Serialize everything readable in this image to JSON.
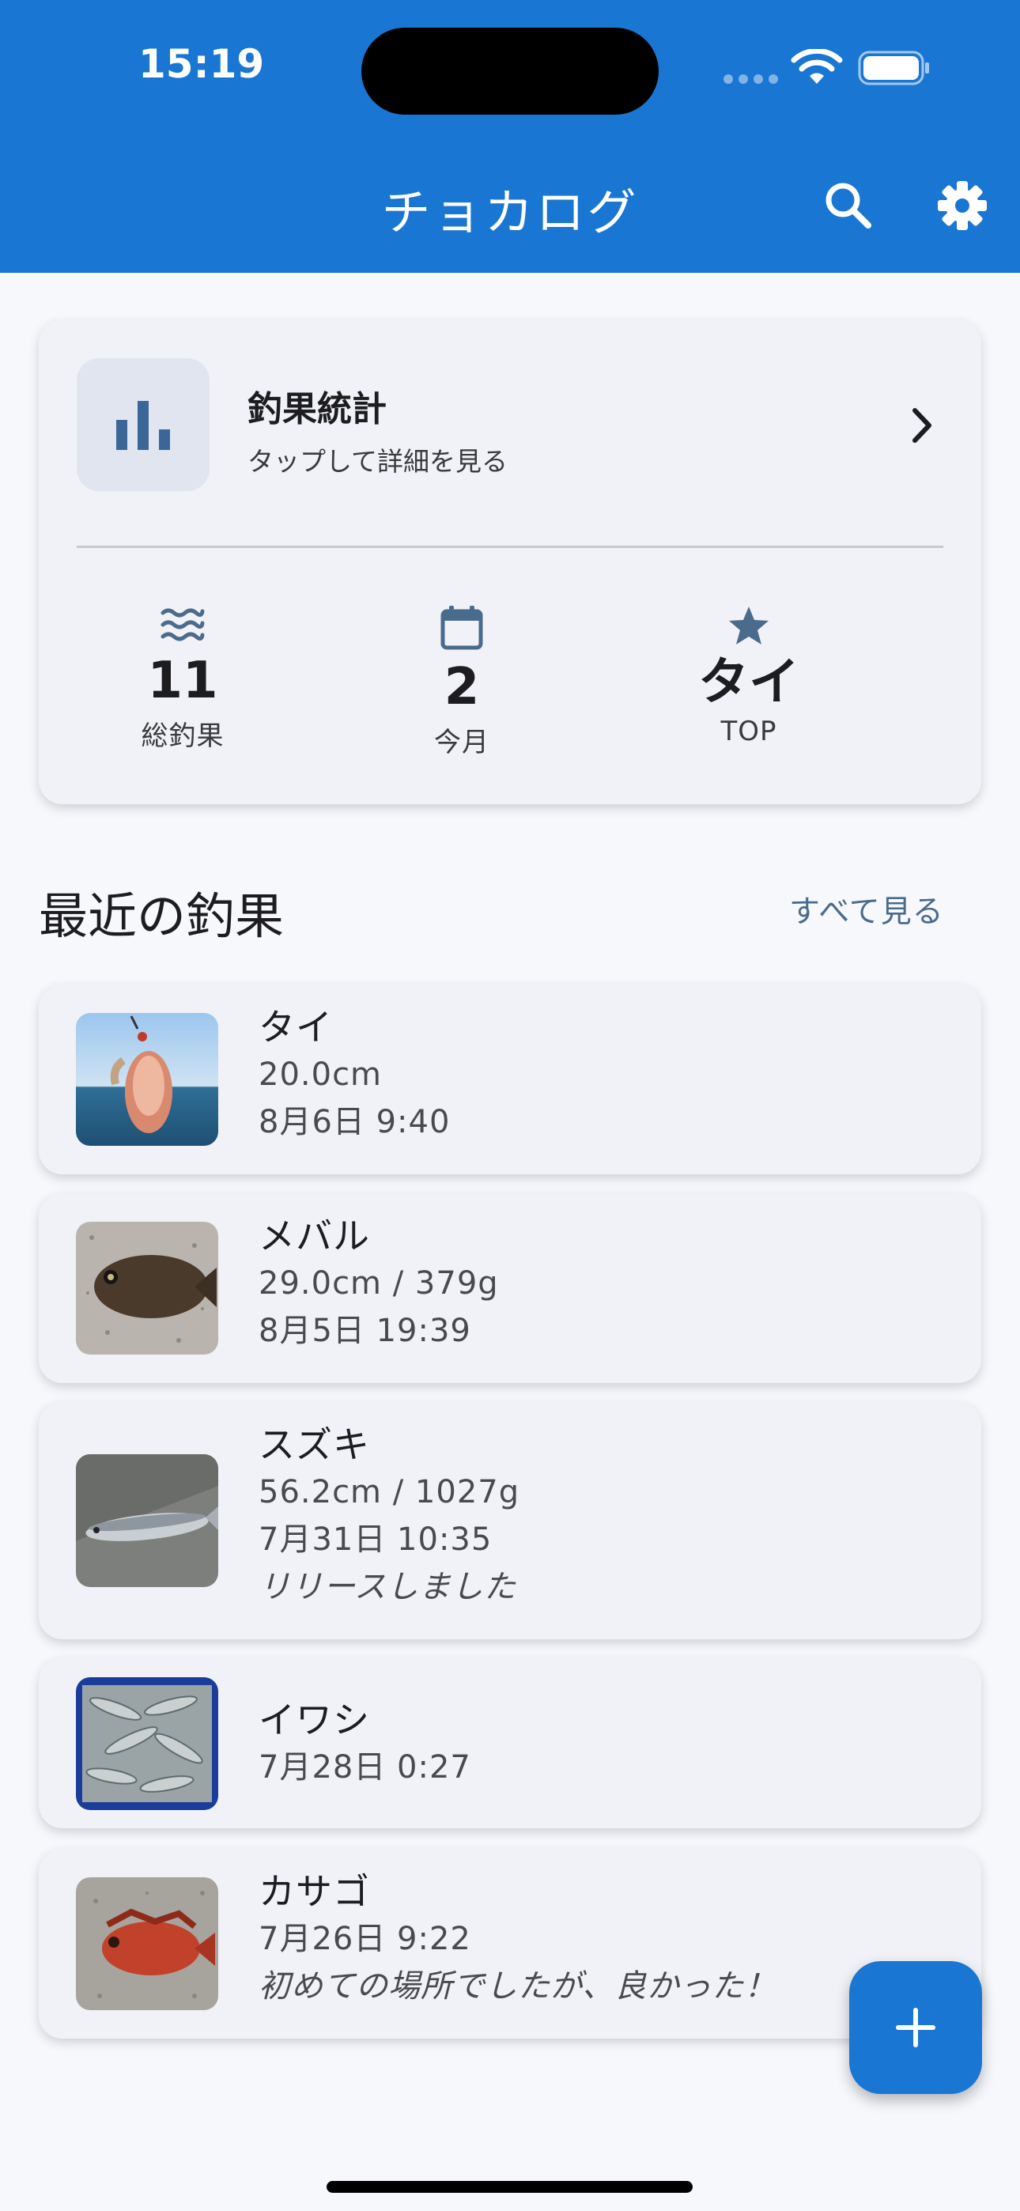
{
  "status_bar": {
    "time": "15:19"
  },
  "app_bar": {
    "title": "チョカログ",
    "search_icon": "search-icon",
    "settings_icon": "gear-icon"
  },
  "stats_card": {
    "icon": "bar-chart-icon",
    "title": "釣果統計",
    "subtitle": "タップして詳細を見る",
    "stats": [
      {
        "icon": "waves-icon",
        "value": "11",
        "label": "総釣果"
      },
      {
        "icon": "calendar-icon",
        "value": "2",
        "label": "今月"
      },
      {
        "icon": "star-icon",
        "value": "タイ",
        "label": "TOP"
      }
    ]
  },
  "recent": {
    "title": "最近の釣果",
    "see_all": "すべて見る",
    "items": [
      {
        "name": "タイ",
        "lines": [
          "20.0cm",
          "8月6日 9:40"
        ],
        "memo": ""
      },
      {
        "name": "メバル",
        "lines": [
          "29.0cm / 379g",
          "8月5日 19:39"
        ],
        "memo": ""
      },
      {
        "name": "スズキ",
        "lines": [
          "56.2cm / 1027g",
          "7月31日 10:35"
        ],
        "memo": "リリースしました"
      },
      {
        "name": "イワシ",
        "lines": [
          "7月28日 0:27"
        ],
        "memo": ""
      },
      {
        "name": "カサゴ",
        "lines": [
          "7月26日 9:22"
        ],
        "memo": "初めての場所でしたが、良かった！"
      }
    ]
  },
  "fab": {
    "icon": "plus-icon"
  },
  "colors": {
    "primary": "#1976d2",
    "accent_icon": "#4a6b8c",
    "card_bg": "#f1f2f7",
    "page_bg": "#f7f8fc"
  }
}
